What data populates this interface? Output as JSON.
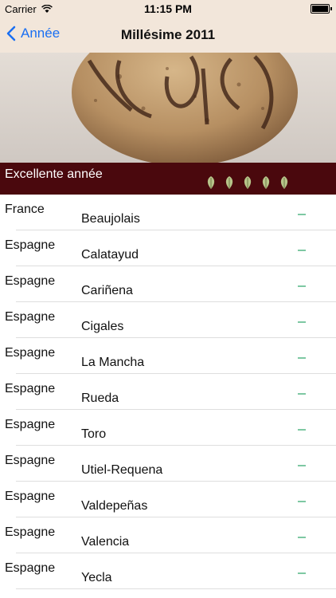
{
  "status_bar": {
    "carrier": "Carrier",
    "time": "11:15 PM"
  },
  "nav": {
    "back_label": "Année",
    "title": "Millésime 2011"
  },
  "rating": {
    "label": "Excellente année",
    "leaf_count": 5,
    "leaf_color": "#b7c48a"
  },
  "colors": {
    "accent": "#1a6ff2",
    "rating_bar": "#4a080d",
    "dash": "#7ec8a3"
  },
  "rows": [
    {
      "country": "France",
      "region": "Beaujolais",
      "value": "–"
    },
    {
      "country": "Espagne",
      "region": "Calatayud",
      "value": "–"
    },
    {
      "country": "Espagne",
      "region": "Cariñena",
      "value": "–"
    },
    {
      "country": "Espagne",
      "region": "Cigales",
      "value": "–"
    },
    {
      "country": "Espagne",
      "region": "La Mancha",
      "value": "–"
    },
    {
      "country": "Espagne",
      "region": "Rueda",
      "value": "–"
    },
    {
      "country": "Espagne",
      "region": "Toro",
      "value": "–"
    },
    {
      "country": "Espagne",
      "region": "Utiel-Requena",
      "value": "–"
    },
    {
      "country": "Espagne",
      "region": "Valdepeñas",
      "value": "–"
    },
    {
      "country": "Espagne",
      "region": "Valencia",
      "value": "–"
    },
    {
      "country": "Espagne",
      "region": "Yecla",
      "value": "–"
    }
  ]
}
